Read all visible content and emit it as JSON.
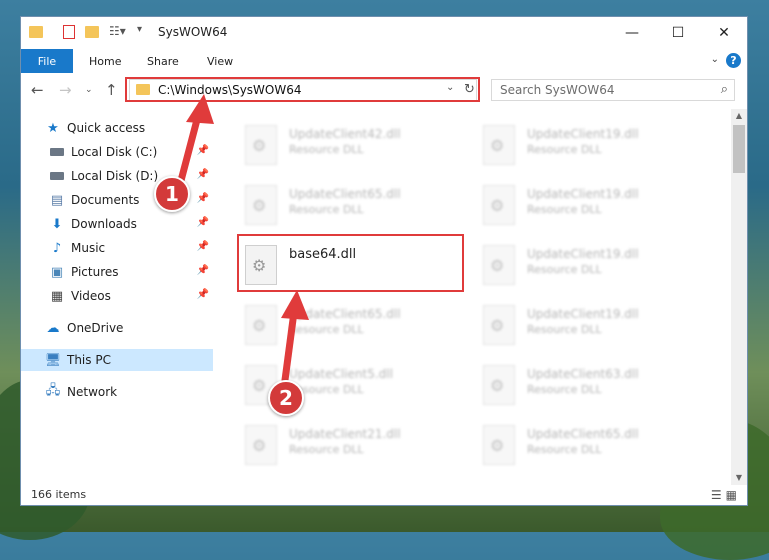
{
  "window": {
    "title": "SysWOW64",
    "controls": {
      "minimize": "—",
      "maximize": "☐",
      "close": "✕"
    }
  },
  "ribbon": {
    "file": "File",
    "tabs": [
      "Home",
      "Share",
      "View"
    ],
    "help": "?"
  },
  "address_bar": {
    "path": "C:\\Windows\\SysWOW64",
    "search_placeholder": "Search SysWOW64"
  },
  "sidebar": {
    "quick_access": "Quick access",
    "quick_items": [
      {
        "label": "Local Disk (C:)",
        "icon": "drive-icon"
      },
      {
        "label": "Local Disk (D:)",
        "icon": "drive-icon"
      },
      {
        "label": "Documents",
        "icon": "documents-icon"
      },
      {
        "label": "Downloads",
        "icon": "downloads-icon"
      },
      {
        "label": "Music",
        "icon": "music-icon"
      },
      {
        "label": "Pictures",
        "icon": "pictures-icon"
      },
      {
        "label": "Videos",
        "icon": "videos-icon"
      }
    ],
    "onedrive": "OneDrive",
    "this_pc": "This PC",
    "network": "Network"
  },
  "files": {
    "left_column": [
      {
        "name": "UpdateClient42.dll",
        "type": "Resource DLL"
      },
      {
        "name": "UpdateClient65.dll",
        "type": "Resource DLL"
      },
      {
        "name": "base64.dll",
        "type": ""
      },
      {
        "name": "UpdateClient65.dll",
        "type": "Resource DLL"
      },
      {
        "name": "UpdateClient5.dll",
        "type": "Resource DLL"
      },
      {
        "name": "UpdateClient21.dll",
        "type": "Resource DLL"
      }
    ],
    "right_column": [
      {
        "name": "UpdateClient19.dll",
        "type": "Resource DLL"
      },
      {
        "name": "UpdateClient19.dll",
        "type": "Resource DLL"
      },
      {
        "name": "UpdateClient19.dll",
        "type": "Resource DLL"
      },
      {
        "name": "UpdateClient19.dll",
        "type": "Resource DLL"
      },
      {
        "name": "UpdateClient63.dll",
        "type": "Resource DLL"
      },
      {
        "name": "UpdateClient65.dll",
        "type": "Resource DLL"
      }
    ]
  },
  "status_bar": {
    "item_count": "166 items"
  },
  "annotations": {
    "step1": "1",
    "step2": "2",
    "color": "#e03b3b"
  }
}
